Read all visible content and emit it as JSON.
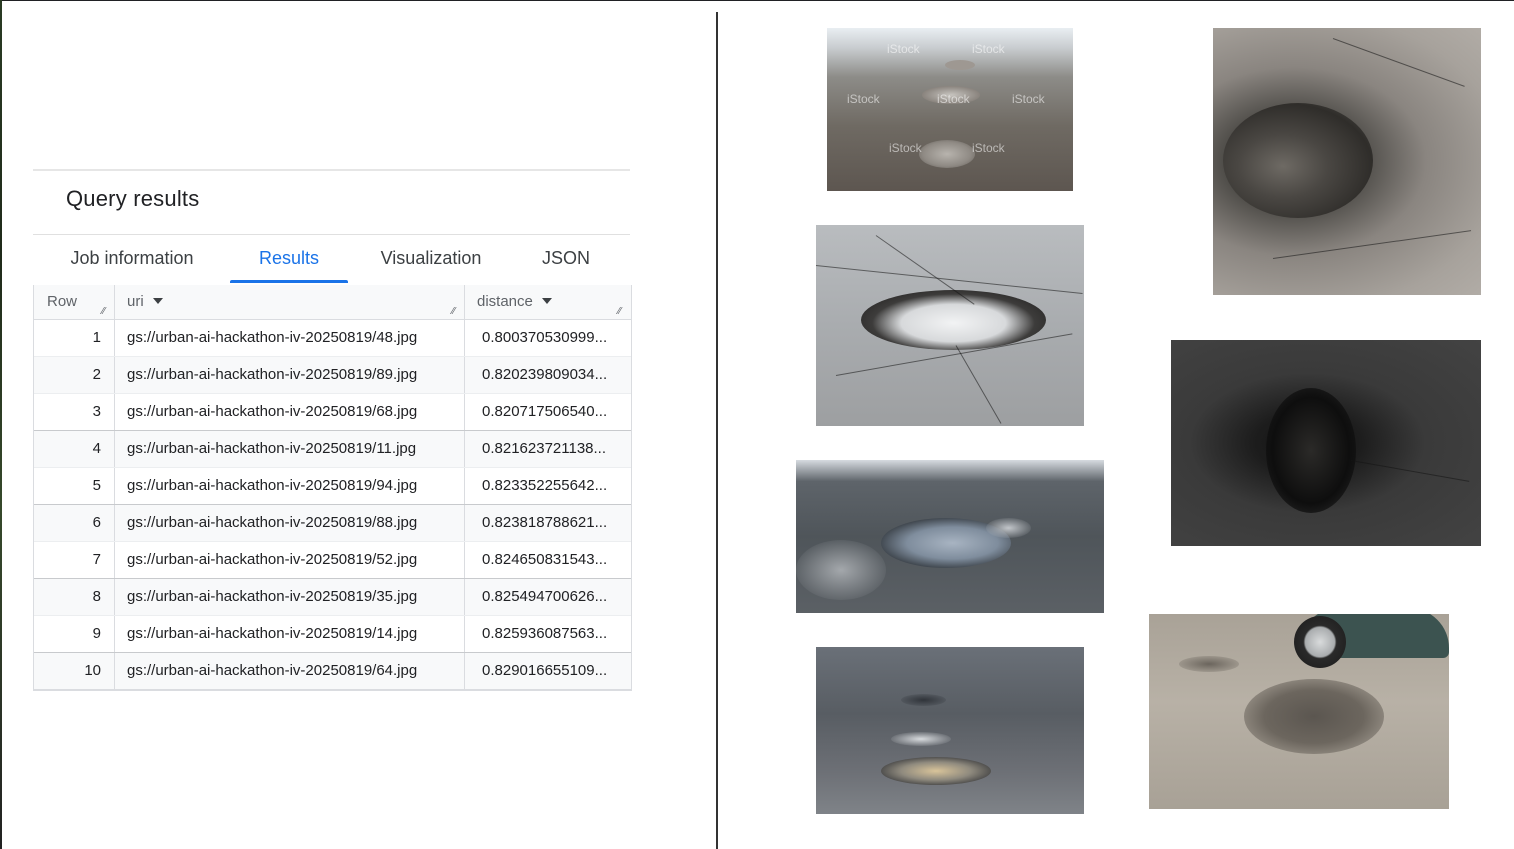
{
  "panel": {
    "title": "Query results",
    "tabs": [
      {
        "label": "Job information",
        "active": false
      },
      {
        "label": "Results",
        "active": true
      },
      {
        "label": "Visualization",
        "active": false
      },
      {
        "label": "JSON",
        "active": false
      }
    ]
  },
  "table": {
    "columns": {
      "row": "Row",
      "uri": "uri",
      "distance": "distance"
    },
    "rows": [
      {
        "row": "1",
        "uri": "gs://urban-ai-hackathon-iv-20250819/48.jpg",
        "distance": "0.800370530999..."
      },
      {
        "row": "2",
        "uri": "gs://urban-ai-hackathon-iv-20250819/89.jpg",
        "distance": "0.820239809034..."
      },
      {
        "row": "3",
        "uri": "gs://urban-ai-hackathon-iv-20250819/68.jpg",
        "distance": "0.820717506540..."
      },
      {
        "row": "4",
        "uri": "gs://urban-ai-hackathon-iv-20250819/11.jpg",
        "distance": "0.821623721138..."
      },
      {
        "row": "5",
        "uri": "gs://urban-ai-hackathon-iv-20250819/94.jpg",
        "distance": "0.823352255642..."
      },
      {
        "row": "6",
        "uri": "gs://urban-ai-hackathon-iv-20250819/88.jpg",
        "distance": "0.823818788621..."
      },
      {
        "row": "7",
        "uri": "gs://urban-ai-hackathon-iv-20250819/52.jpg",
        "distance": "0.824650831543..."
      },
      {
        "row": "8",
        "uri": "gs://urban-ai-hackathon-iv-20250819/35.jpg",
        "distance": "0.825494700626..."
      },
      {
        "row": "9",
        "uri": "gs://urban-ai-hackathon-iv-20250819/14.jpg",
        "distance": "0.825936087563..."
      },
      {
        "row": "10",
        "uri": "gs://urban-ai-hackathon-iv-20250819/64.jpg",
        "distance": "0.829016655109..."
      }
    ]
  },
  "photos": {
    "watermark": "iStock"
  },
  "colors": {
    "accent": "#1a73e8",
    "text": "#202124",
    "header_bg": "#f8f9fa",
    "border": "#dadce0"
  },
  "icons": {
    "sort": "caret-down-icon",
    "resize": "column-resize-icon"
  }
}
